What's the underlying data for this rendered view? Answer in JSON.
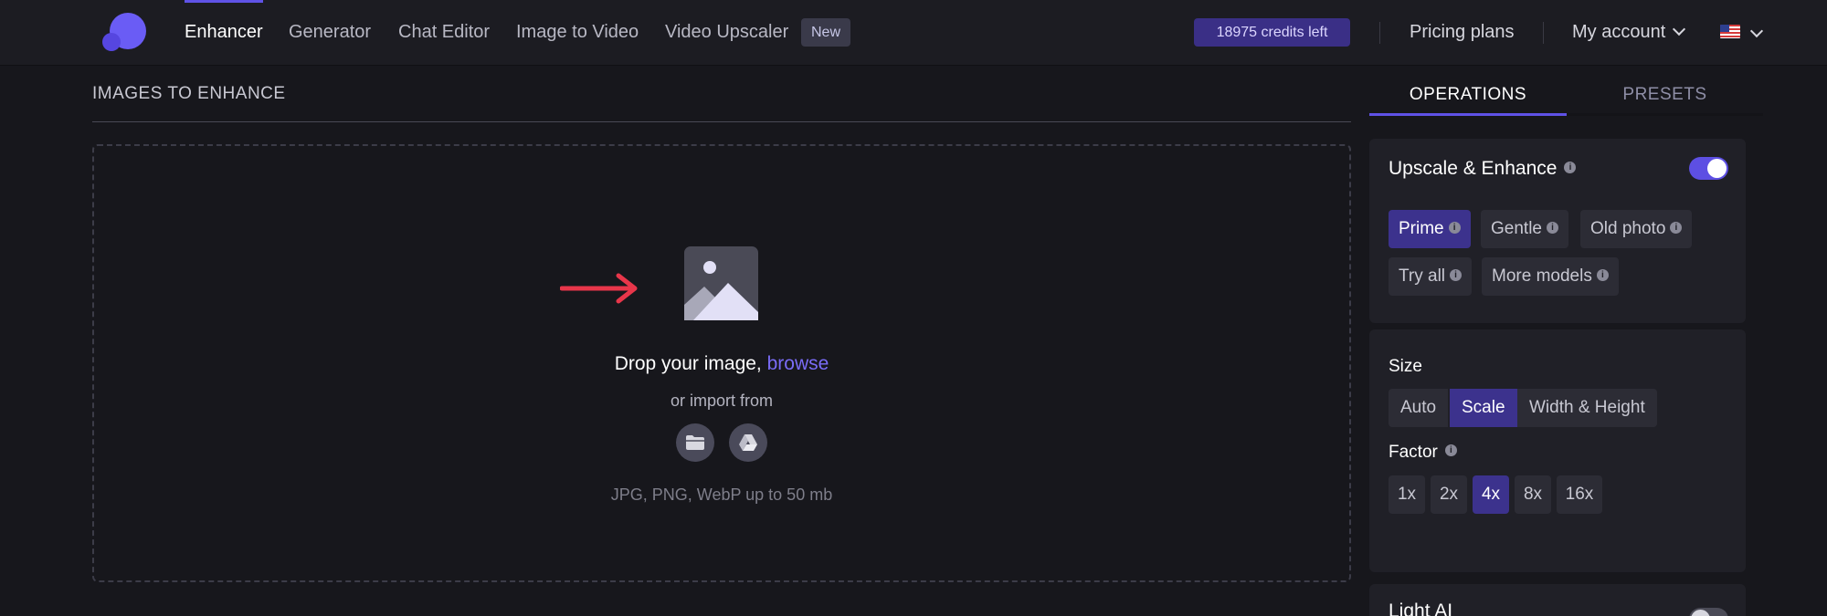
{
  "nav": {
    "items": [
      {
        "label": "Enhancer",
        "active": true
      },
      {
        "label": "Generator",
        "active": false
      },
      {
        "label": "Chat Editor",
        "active": false
      },
      {
        "label": "Image to Video",
        "active": false
      },
      {
        "label": "Video Upscaler",
        "active": false
      }
    ],
    "new_badge": "New",
    "credits": "18975 credits left",
    "pricing": "Pricing plans",
    "account": "My account",
    "language_icon": "us-flag-icon"
  },
  "main": {
    "section_title": "IMAGES TO ENHANCE",
    "drop_text": "Drop your image,",
    "browse_link": "browse",
    "import_text": "or import from",
    "import_sources": [
      "folder-icon",
      "google-drive-icon"
    ],
    "formats": "JPG, PNG, WebP up to 50 mb"
  },
  "panel": {
    "tabs": [
      {
        "label": "OPERATIONS",
        "active": true
      },
      {
        "label": "PRESETS",
        "active": false
      }
    ],
    "upscale": {
      "title": "Upscale & Enhance",
      "enabled": true,
      "models": [
        {
          "label": "Prime",
          "selected": true
        },
        {
          "label": "Gentle",
          "selected": false
        },
        {
          "label": "Old photo",
          "selected": false
        },
        {
          "label": "Try all",
          "selected": false
        },
        {
          "label": "More models",
          "selected": false
        }
      ]
    },
    "size": {
      "label": "Size",
      "modes": [
        {
          "label": "Auto",
          "selected": false
        },
        {
          "label": "Scale",
          "selected": true
        },
        {
          "label": "Width & Height",
          "selected": false
        }
      ],
      "factor_label": "Factor",
      "factors": [
        {
          "label": "1x",
          "selected": false
        },
        {
          "label": "2x",
          "selected": false
        },
        {
          "label": "4x",
          "selected": true
        },
        {
          "label": "8x",
          "selected": false
        },
        {
          "label": "16x",
          "selected": false
        }
      ]
    },
    "next_card": {
      "title": "Light AI",
      "enabled": false
    }
  },
  "colors": {
    "accent": "#5f52e6",
    "selected_chip": "#3c328d",
    "browse": "#7a6cf7",
    "arrow": "#e8364a"
  }
}
